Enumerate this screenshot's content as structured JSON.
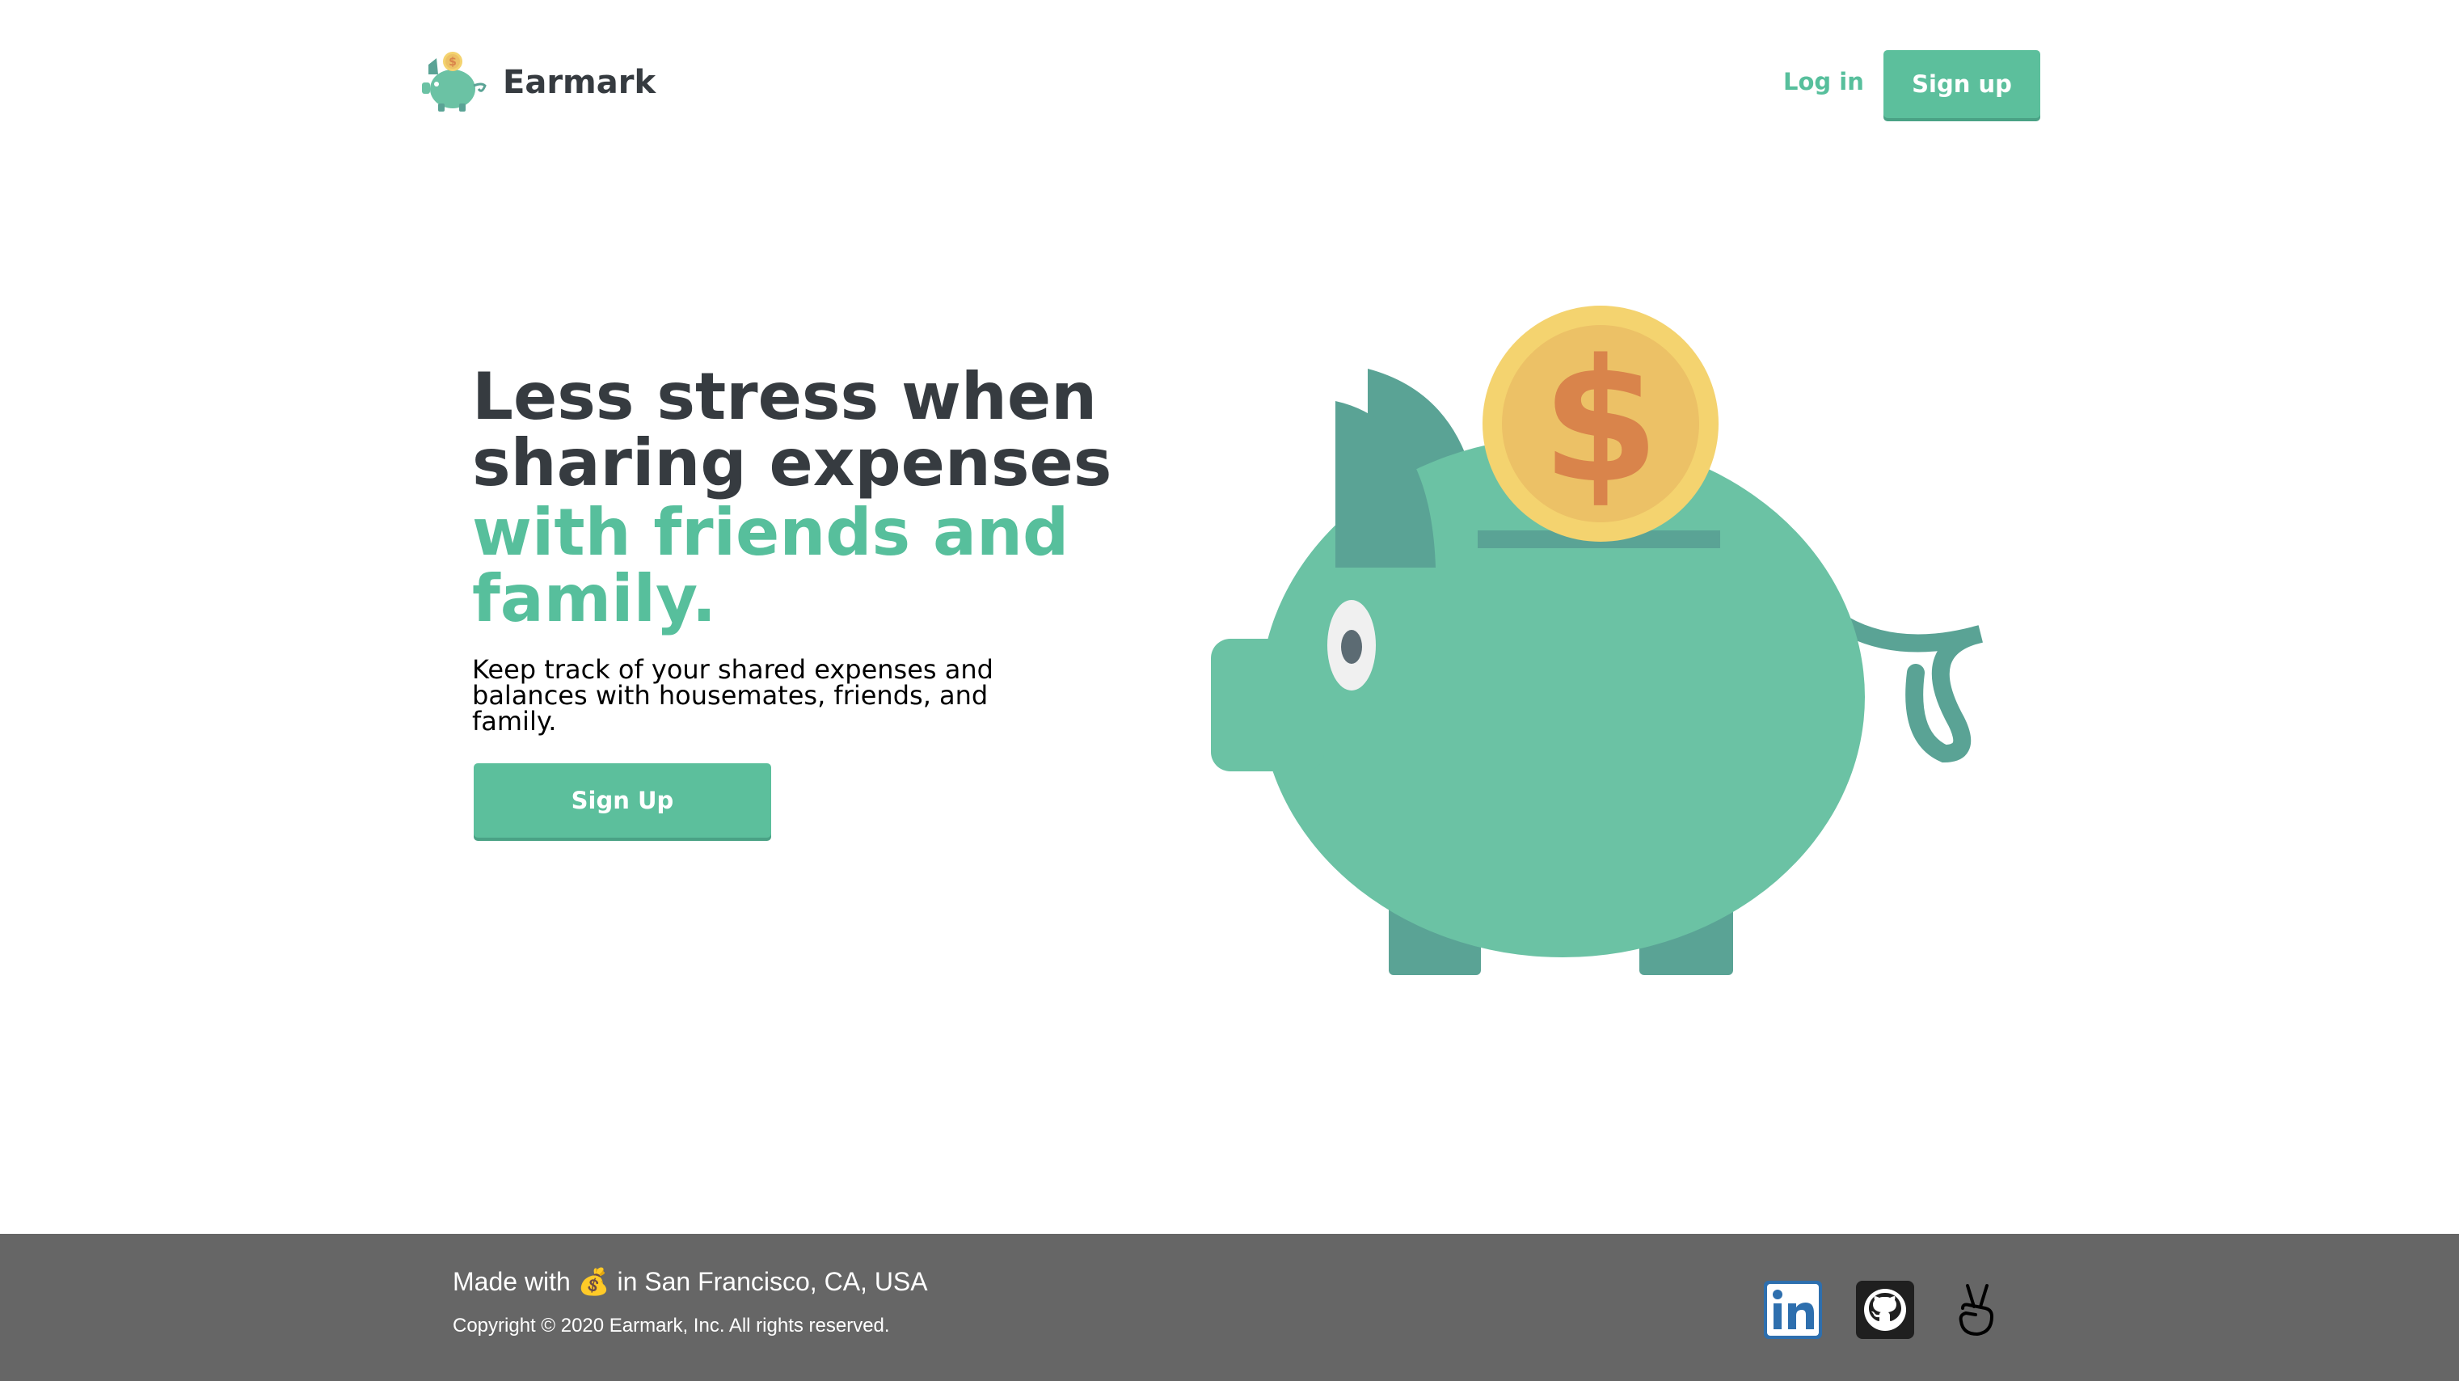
{
  "header": {
    "brand": "Earmark",
    "login_label": "Log in",
    "signup_label": "Sign up"
  },
  "hero": {
    "headline": "Less stress when sharing expenses",
    "headline_accent": "with friends and family.",
    "subtext": "Keep track of your shared expenses and balances with housemates, friends, and family.",
    "cta_label": "Sign Up",
    "illustration": "piggy-bank-with-coin",
    "coin_symbol": "$"
  },
  "footer": {
    "made_with_prefix": "Made with",
    "made_with_emoji": "💰",
    "made_with_suffix": "in San Francisco, CA, USA",
    "copyright": "Copyright © 2020 Earmark, Inc. All rights reserved.",
    "social": [
      "linkedin-icon",
      "github-icon",
      "angellist-icon"
    ]
  },
  "colors": {
    "brand_green": "#5cbf9c",
    "dark_text": "#363b40",
    "pig_body": "#6bc2a4",
    "pig_dark": "#5aa395",
    "coin_outer": "#f4d36f",
    "coin_inner": "#ecc166",
    "coin_symbol": "#d9844b",
    "footer_bg": "#666666"
  }
}
